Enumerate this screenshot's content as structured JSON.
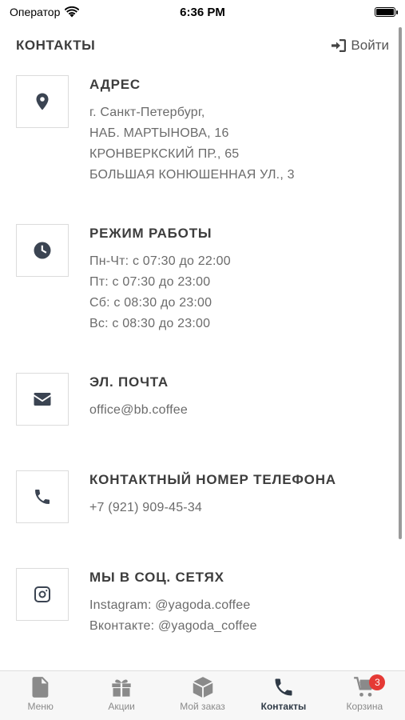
{
  "status_bar": {
    "carrier": "Оператор",
    "time": "6:36 PM"
  },
  "header": {
    "title": "КОНТАКТЫ",
    "login_label": "Войти"
  },
  "sections": [
    {
      "icon": "location-pin-icon",
      "title": "АДРЕС",
      "lines": [
        "г. Санкт-Петербург,",
        "НАБ. МАРТЫНОВА, 16",
        "КРОНВЕРКСКИЙ ПР., 65",
        "БОЛЬШАЯ КОНЮШЕННАЯ УЛ., 3"
      ]
    },
    {
      "icon": "clock-icon",
      "title": "РЕЖИМ РАБОТЫ",
      "lines": [
        "Пн-Чт: с 07:30 до 22:00",
        "Пт: с 07:30 до 23:00",
        "Сб: с 08:30 до 23:00",
        "Вс: с 08:30 до 23:00"
      ]
    },
    {
      "icon": "envelope-icon",
      "title": "ЭЛ. ПОЧТА",
      "lines": [
        "office@bb.coffee"
      ]
    },
    {
      "icon": "phone-icon",
      "title": "КОНТАКТНЫЙ НОМЕР ТЕЛЕФОНА",
      "lines": [
        "+7 (921) 909-45-34"
      ]
    },
    {
      "icon": "instagram-icon",
      "title": "МЫ В СОЦ. СЕТЯХ",
      "lines": [
        "Instagram: @yagoda.coffee",
        "Вконтакте: @yagoda_coffee"
      ]
    }
  ],
  "tabs": [
    {
      "icon": "document-icon",
      "label": "Меню",
      "active": false
    },
    {
      "icon": "gift-icon",
      "label": "Акции",
      "active": false
    },
    {
      "icon": "box-icon",
      "label": "Мой заказ",
      "active": false
    },
    {
      "icon": "phone-icon",
      "label": "Контакты",
      "active": true
    },
    {
      "icon": "cart-icon",
      "label": "Корзина",
      "active": false,
      "badge": "3"
    }
  ],
  "colors": {
    "icon": "#3b4452",
    "badge": "#e53935",
    "text": "#3d3d3d",
    "muted": "#6b6b6b"
  }
}
